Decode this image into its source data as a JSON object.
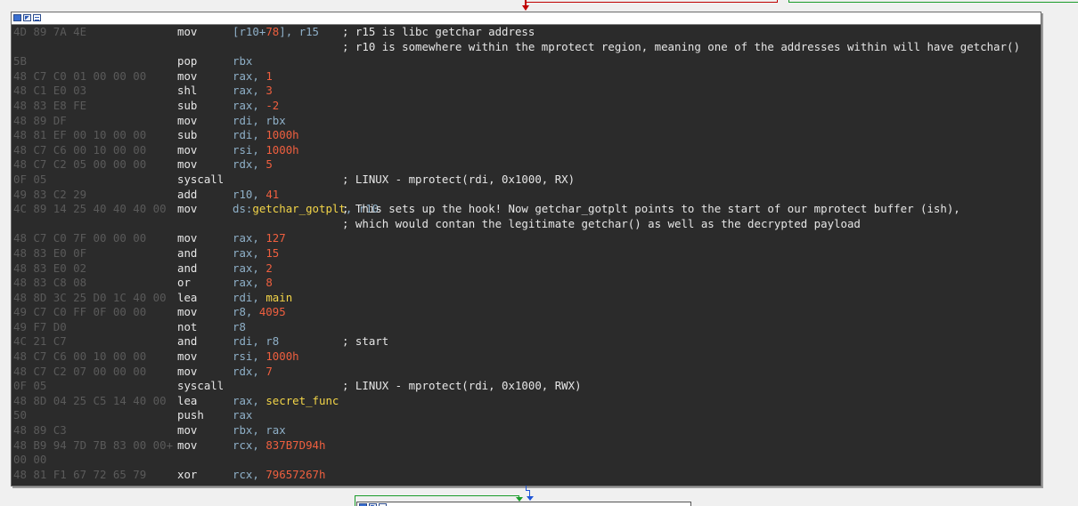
{
  "node": {
    "title_icons": [
      "graph-node-icon",
      "edit-node-icon",
      "node-color-icon"
    ],
    "rows": [
      {
        "bytes": "4D 89 7A 4E",
        "mnem": "mov",
        "ops": [
          {
            "t": "[r10+",
            "c": "reg"
          },
          {
            "t": "78",
            "c": "num"
          },
          {
            "t": "], r15",
            "c": "reg"
          }
        ],
        "comment": "; r15 is libc getchar address"
      },
      {
        "bytes": "",
        "mnem": "",
        "ops": [],
        "comment": "; r10 is somewhere within the mprotect region, meaning one of the addresses within will have getchar()"
      },
      {
        "bytes": "5B",
        "mnem": "pop",
        "ops": [
          {
            "t": "rbx",
            "c": "reg"
          }
        ],
        "comment": ""
      },
      {
        "bytes": "48 C7 C0 01 00 00 00",
        "mnem": "mov",
        "ops": [
          {
            "t": "rax, ",
            "c": "reg"
          },
          {
            "t": "1",
            "c": "num"
          }
        ],
        "comment": ""
      },
      {
        "bytes": "48 C1 E0 03",
        "mnem": "shl",
        "ops": [
          {
            "t": "rax, ",
            "c": "reg"
          },
          {
            "t": "3",
            "c": "num"
          }
        ],
        "comment": ""
      },
      {
        "bytes": "48 83 E8 FE",
        "mnem": "sub",
        "ops": [
          {
            "t": "rax, ",
            "c": "reg"
          },
          {
            "t": "-2",
            "c": "num"
          }
        ],
        "comment": ""
      },
      {
        "bytes": "48 89 DF",
        "mnem": "mov",
        "ops": [
          {
            "t": "rdi, rbx",
            "c": "reg"
          }
        ],
        "comment": ""
      },
      {
        "bytes": "48 81 EF 00 10 00 00",
        "mnem": "sub",
        "ops": [
          {
            "t": "rdi, ",
            "c": "reg"
          },
          {
            "t": "1000h",
            "c": "num"
          }
        ],
        "comment": ""
      },
      {
        "bytes": "48 C7 C6 00 10 00 00",
        "mnem": "mov",
        "ops": [
          {
            "t": "rsi, ",
            "c": "reg"
          },
          {
            "t": "1000h",
            "c": "num"
          }
        ],
        "comment": ""
      },
      {
        "bytes": "48 C7 C2 05 00 00 00",
        "mnem": "mov",
        "ops": [
          {
            "t": "rdx, ",
            "c": "reg"
          },
          {
            "t": "5",
            "c": "num"
          }
        ],
        "comment": ""
      },
      {
        "bytes": "0F 05",
        "mnem": "syscall",
        "ops": [],
        "comment": "; LINUX - mprotect(rdi, 0x1000, RX)"
      },
      {
        "bytes": "49 83 C2 29",
        "mnem": "add",
        "ops": [
          {
            "t": "r10, ",
            "c": "reg"
          },
          {
            "t": "41",
            "c": "num"
          }
        ],
        "comment": ""
      },
      {
        "bytes": "4C 89 14 25 40 40 40 00",
        "mnem": "mov",
        "ops": [
          {
            "t": "ds:",
            "c": "reg"
          },
          {
            "t": "getchar_gotplt",
            "c": "sym"
          },
          {
            "t": ", r10",
            "c": "reg"
          }
        ],
        "comment": "; This sets up the hook! Now getchar_gotplt points to the start of our mprotect buffer (ish),"
      },
      {
        "bytes": "",
        "mnem": "",
        "ops": [],
        "comment": "; which would contan the legitimate getchar() as well as the decrypted payload"
      },
      {
        "bytes": "48 C7 C0 7F 00 00 00",
        "mnem": "mov",
        "ops": [
          {
            "t": "rax, ",
            "c": "reg"
          },
          {
            "t": "127",
            "c": "num"
          }
        ],
        "comment": ""
      },
      {
        "bytes": "48 83 E0 0F",
        "mnem": "and",
        "ops": [
          {
            "t": "rax, ",
            "c": "reg"
          },
          {
            "t": "15",
            "c": "num"
          }
        ],
        "comment": ""
      },
      {
        "bytes": "48 83 E0 02",
        "mnem": "and",
        "ops": [
          {
            "t": "rax, ",
            "c": "reg"
          },
          {
            "t": "2",
            "c": "num"
          }
        ],
        "comment": ""
      },
      {
        "bytes": "48 83 C8 08",
        "mnem": "or",
        "ops": [
          {
            "t": "rax, ",
            "c": "reg"
          },
          {
            "t": "8",
            "c": "num"
          }
        ],
        "comment": ""
      },
      {
        "bytes": "48 8D 3C 25 D0 1C 40 00",
        "mnem": "lea",
        "ops": [
          {
            "t": "rdi, ",
            "c": "reg"
          },
          {
            "t": "main",
            "c": "sym"
          }
        ],
        "comment": ""
      },
      {
        "bytes": "49 C7 C0 FF 0F 00 00",
        "mnem": "mov",
        "ops": [
          {
            "t": "r8, ",
            "c": "reg"
          },
          {
            "t": "4095",
            "c": "num"
          }
        ],
        "comment": ""
      },
      {
        "bytes": "49 F7 D0",
        "mnem": "not",
        "ops": [
          {
            "t": "r8",
            "c": "reg"
          }
        ],
        "comment": ""
      },
      {
        "bytes": "4C 21 C7",
        "mnem": "and",
        "ops": [
          {
            "t": "rdi, r8",
            "c": "reg"
          }
        ],
        "comment": "; start"
      },
      {
        "bytes": "48 C7 C6 00 10 00 00",
        "mnem": "mov",
        "ops": [
          {
            "t": "rsi, ",
            "c": "reg"
          },
          {
            "t": "1000h",
            "c": "num"
          }
        ],
        "comment": ""
      },
      {
        "bytes": "48 C7 C2 07 00 00 00",
        "mnem": "mov",
        "ops": [
          {
            "t": "rdx, ",
            "c": "reg"
          },
          {
            "t": "7",
            "c": "num"
          }
        ],
        "comment": ""
      },
      {
        "bytes": "0F 05",
        "mnem": "syscall",
        "ops": [],
        "comment": "; LINUX - mprotect(rdi, 0x1000, RWX)"
      },
      {
        "bytes": "48 8D 04 25 C5 14 40 00",
        "mnem": "lea",
        "ops": [
          {
            "t": "rax, ",
            "c": "reg"
          },
          {
            "t": "secret_func",
            "c": "sym"
          }
        ],
        "comment": ""
      },
      {
        "bytes": "50",
        "mnem": "push",
        "ops": [
          {
            "t": "rax",
            "c": "reg"
          }
        ],
        "comment": ""
      },
      {
        "bytes": "48 89 C3",
        "mnem": "mov",
        "ops": [
          {
            "t": "rbx, rax",
            "c": "reg"
          }
        ],
        "comment": ""
      },
      {
        "bytes": "48 B9 94 7D 7B 83 00 00+",
        "mnem": "mov",
        "ops": [
          {
            "t": "rcx, ",
            "c": "reg"
          },
          {
            "t": "837B7D94h",
            "c": "num"
          }
        ],
        "comment": ""
      },
      {
        "bytes": "00 00",
        "mnem": "",
        "ops": [],
        "comment": ""
      },
      {
        "bytes": "48 81 F1 67 72 65 79",
        "mnem": "xor",
        "ops": [
          {
            "t": "rcx, ",
            "c": "reg"
          },
          {
            "t": "79657267h",
            "c": "num"
          }
        ],
        "comment": ""
      }
    ]
  },
  "colors": {
    "background": "#f0f0f0",
    "node_bg": "#2b2b2b",
    "bytes": "#5a5a5a",
    "register": "#8fb0c8",
    "number": "#ef5f3f",
    "symbol": "#f3d548",
    "text": "#e6e6e6",
    "edge_red": "#c00000",
    "edge_green": "#1a9c2a",
    "edge_blue": "#1f55d6"
  }
}
